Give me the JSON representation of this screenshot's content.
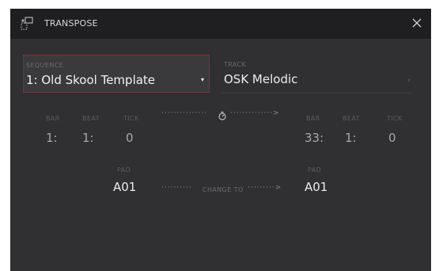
{
  "dialog": {
    "title": "TRANSPOSE",
    "close_symbol": "×",
    "icon": "transpose-icon",
    "accent_color": "#8a2a3c"
  },
  "sequence": {
    "label": "SEQUENCE",
    "value": "1: Old Skool Template",
    "dropdown_symbol": "▾"
  },
  "track": {
    "label": "TRACK",
    "value": "OSK Melodic",
    "dropdown_symbol": "▾"
  },
  "range": {
    "start": {
      "bar_label": "BAR",
      "beat_label": "BEAT",
      "tick_label": "TICK",
      "bar": "1:",
      "beat": "1:",
      "tick": "0"
    },
    "end": {
      "bar_label": "BAR",
      "beat_label": "BEAT",
      "tick_label": "TICK",
      "bar": "33:",
      "beat": "1:",
      "tick": "0"
    },
    "connector_icon": "timer-icon"
  },
  "pad": {
    "from_label": "PAD",
    "from_value": "A01",
    "change_label": "CHANGE TO",
    "to_label": "PAD",
    "to_value": "A01"
  }
}
